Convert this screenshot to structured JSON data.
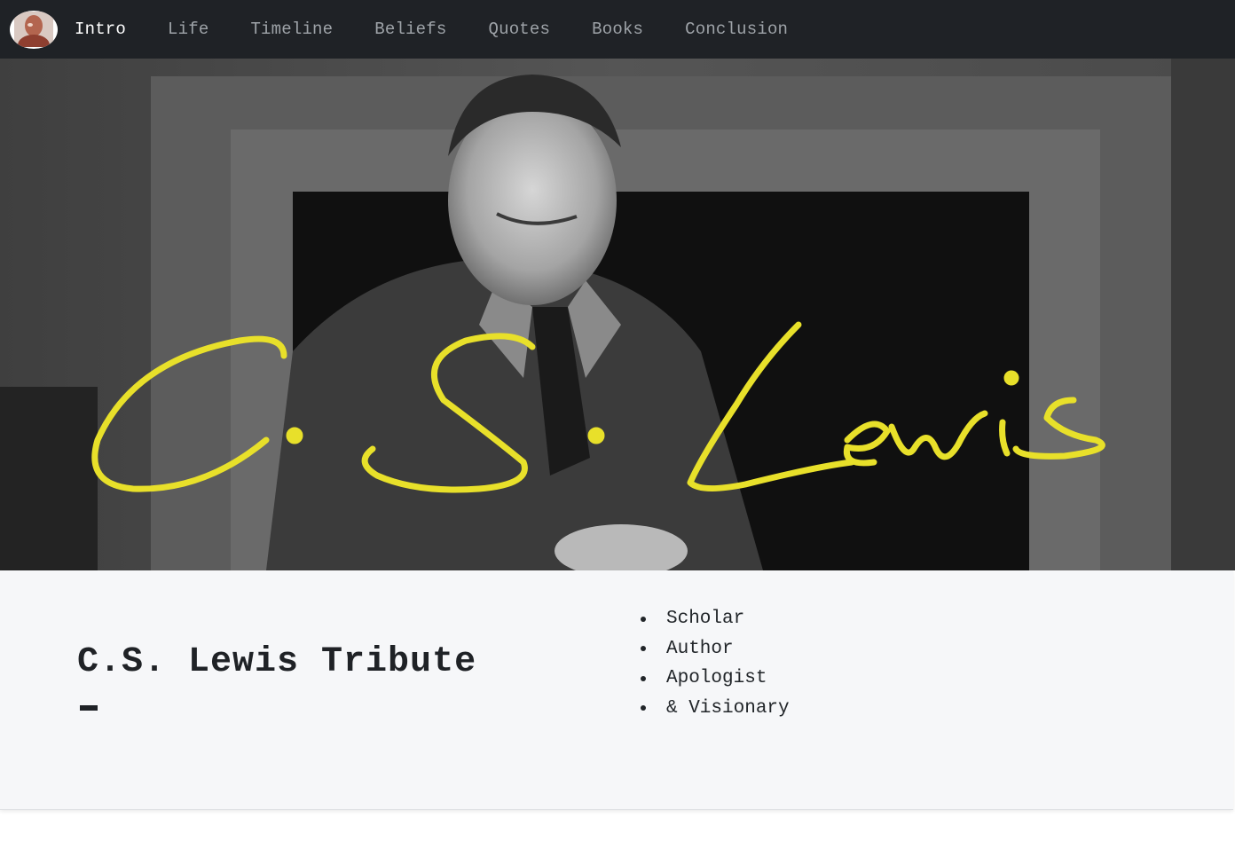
{
  "nav": {
    "brand_icon": "portrait-avatar-icon",
    "items": [
      {
        "label": "Intro",
        "active": true
      },
      {
        "label": "Life",
        "active": false
      },
      {
        "label": "Timeline",
        "active": false
      },
      {
        "label": "Beliefs",
        "active": false
      },
      {
        "label": "Quotes",
        "active": false
      },
      {
        "label": "Books",
        "active": false
      },
      {
        "label": "Conclusion",
        "active": false
      }
    ]
  },
  "hero": {
    "signature_text": "C.S. Lewis",
    "signature_color": "#e8e02a"
  },
  "intro": {
    "title": "C.S. Lewis Tribute",
    "traits": [
      "Scholar",
      "Author",
      "Apologist",
      "& Visionary"
    ]
  },
  "colors": {
    "navbar": "#1f2226",
    "nav_active": "#ffffff",
    "nav_inactive": "#9ea3a8",
    "panel": "#f6f7f9"
  }
}
